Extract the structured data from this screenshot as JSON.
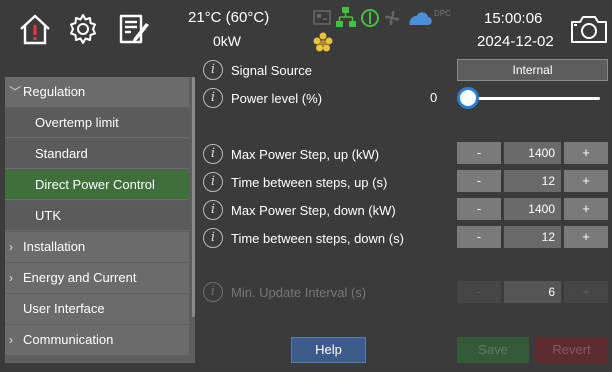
{
  "header": {
    "temperature": "21°C (60°C)",
    "power": "0kW",
    "status_badge": "DPC",
    "time": "15:00:06",
    "date": "2024-12-02"
  },
  "colors": {
    "accent_blue": "#2a7fd4",
    "active_green": "#3f6f3a",
    "status_green": "#3cc43c",
    "alert_red": "#e23a3a",
    "flower_yellow": "#e8c23a"
  },
  "sidebar": {
    "items": [
      {
        "label": "Regulation",
        "chevron": "﹀"
      },
      {
        "label": "Overtemp limit"
      },
      {
        "label": "Standard"
      },
      {
        "label": "Direct Power Control"
      },
      {
        "label": "UTK"
      },
      {
        "label": "Installation",
        "chevron": "›"
      },
      {
        "label": "Energy and Current",
        "chevron": "›"
      },
      {
        "label": "User Interface"
      },
      {
        "label": "Communication",
        "chevron": "›"
      }
    ],
    "help_label": "Help"
  },
  "settings": {
    "signal_source": {
      "label": "Signal Source",
      "value": "Internal"
    },
    "power_level": {
      "label": "Power level (%)",
      "value": "0",
      "fraction": 0.0
    },
    "max_step_up": {
      "label": "Max Power Step, up (kW)",
      "value": "1400"
    },
    "time_up": {
      "label": "Time between steps, up (s)",
      "value": "12"
    },
    "max_step_down": {
      "label": "Max Power Step, down (kW)",
      "value": "1400"
    },
    "time_down": {
      "label": "Time between steps, down (s)",
      "value": "12"
    },
    "min_update": {
      "label": "Min. Update Interval (s)",
      "value": "6"
    },
    "minus_label": "-",
    "plus_label": "+",
    "info_glyph": "i"
  },
  "footer": {
    "save_label": "Save",
    "revert_label": "Revert"
  }
}
